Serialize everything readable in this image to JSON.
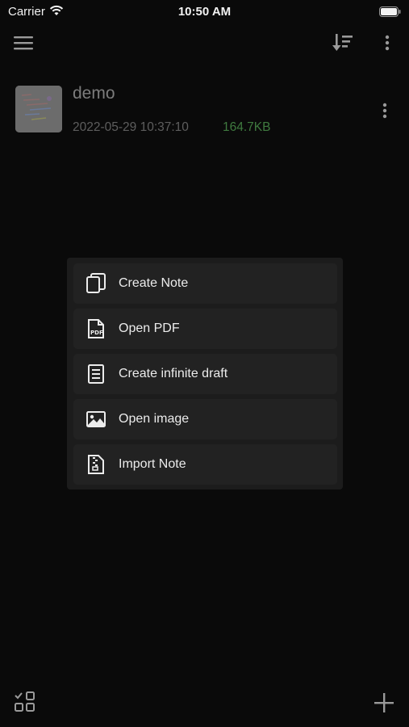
{
  "status_bar": {
    "carrier": "Carrier",
    "time": "10:50 AM"
  },
  "toolbar": {
    "menu_icon": "hamburger-icon",
    "sort_icon": "sort-descending-icon",
    "more_icon": "vertical-dots-icon"
  },
  "files": [
    {
      "name": "demo",
      "date": "2022-05-29 10:37:10",
      "size": "164.7KB"
    }
  ],
  "popup": {
    "items": [
      {
        "label": "Create Note",
        "icon": "copy-pages-icon"
      },
      {
        "label": "Open PDF",
        "icon": "pdf-file-icon"
      },
      {
        "label": "Create infinite draft",
        "icon": "document-icon"
      },
      {
        "label": "Open image",
        "icon": "image-icon"
      },
      {
        "label": "Import Note",
        "icon": "zip-file-icon"
      }
    ]
  },
  "bottom_bar": {
    "left_icon": "select-grid-icon",
    "right_icon": "plus-icon"
  },
  "colors": {
    "background": "#0a0a0a",
    "popup": "#1c1c1c",
    "item": "#222222",
    "size_green": "#3f7a3f"
  }
}
